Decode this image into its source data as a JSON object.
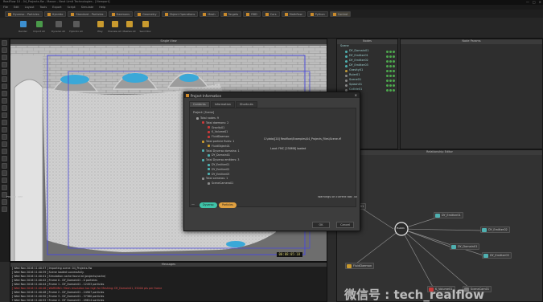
{
  "window": {
    "title": "RealFlow 10 - 04_Projects.flw - Maxon - Next Limit Technologies - [Viewport]"
  },
  "menu": [
    "File",
    "Edit",
    "Layout",
    "Tools",
    "Export",
    "Script",
    "Simulate",
    "Help"
  ],
  "shelf_tabs": [
    {
      "label": "Dyverso - Particles"
    },
    {
      "label": "Hybrido"
    },
    {
      "label": "Standard - Particles"
    },
    {
      "label": "Daemons"
    },
    {
      "label": "Geometry"
    },
    {
      "label": "Object Operations"
    },
    {
      "label": "Mesh"
    },
    {
      "label": "Targets"
    },
    {
      "label": "RBD"
    },
    {
      "label": "Cars"
    },
    {
      "label": "Mathflow"
    },
    {
      "label": "Python"
    },
    {
      "label": "Control",
      "active": true
    }
  ],
  "tools": [
    {
      "label": "Render",
      "color": "#3c8fd0"
    },
    {
      "label": "Import All",
      "color": "#4a9a4a"
    },
    {
      "label": "Dyverso All",
      "color": "#5a5a5a"
    },
    {
      "label": "Hybrido All",
      "color": "#5a5a5a"
    },
    {
      "label": "Play",
      "color": "#c99a2e"
    },
    {
      "label": "Preview All",
      "color": "#c99a2e"
    },
    {
      "label": "Meshes All",
      "color": "#c99a2e"
    },
    {
      "label": "Send Rov",
      "color": "#c99a2e"
    }
  ],
  "viewport": {
    "title": "Single View",
    "timecode": "00:08:05:18"
  },
  "outliner": {
    "title": "Nodes",
    "root": "Scene",
    "items": [
      {
        "label": "DY_Domain01",
        "color": "#4fb0b0"
      },
      {
        "label": "DY_Emitter01",
        "color": "#4fb0b0"
      },
      {
        "label": "DY_Emitter02",
        "color": "#4fb0b0"
      },
      {
        "label": "DY_Emitter03",
        "color": "#4fb0b0"
      },
      {
        "label": "Gravity01",
        "color": "#c09b3a"
      },
      {
        "label": "Ruler01",
        "color": "#8a8a8a"
      },
      {
        "label": "Scene01",
        "color": "#8a8a8a"
      },
      {
        "label": "Splash01",
        "color": "#8a8a8a"
      },
      {
        "label": "Collide01",
        "color": "#8a8a8a"
      }
    ]
  },
  "node_params": {
    "title": "Node Params"
  },
  "relationship_editor": {
    "title": "Relationship Editor",
    "nodes": [
      {
        "label": "Gravity01",
        "color": "#c93a3a"
      },
      {
        "label": "DY_Emitter01",
        "color": "#4fb0b0"
      },
      {
        "label": "DY_Domain01",
        "color": "#4fb0b0"
      },
      {
        "label": "DY_Emitter02",
        "color": "#4fb0b0"
      },
      {
        "label": "DY_Emitter03",
        "color": "#4fb0b0"
      },
      {
        "label": "FluidDaemon",
        "color": "#c99a2e"
      },
      {
        "label": "K_Volume01",
        "color": "#c93a3a"
      },
      {
        "label": "SceneCam01",
        "color": "#7a7a7a"
      }
    ],
    "hub_label": "Hub01"
  },
  "console": {
    "title": "Messages",
    "lines": [
      {
        "text": "[  Wed Nov 2016  11:40:37  ] Importing scene: 04_Projects.flw",
        "kind": "info"
      },
      {
        "text": "[  Wed Nov 2016  11:40:39  ] Scene loaded successfully.",
        "kind": "info"
      },
      {
        "text": "[  Wed Nov 2016  11:40:41  ] Simulation cache found at /projects/cache/",
        "kind": "info"
      },
      {
        "text": "[  Wed Nov 2016  11:40:42  ] Frame 0 - DY_Domain01 - 0 particles",
        "kind": "info"
      },
      {
        "text": "[  Wed Nov 2016  11:40:44  ] Frame 1 - DY_Domain01 - 12453 particles",
        "kind": "info"
      },
      {
        "text": "[  Wed Nov 2016  11:40:46  ] WARNING: Mesh resolution too high for Meshing: DY_Domain01, 25000 pts per frame",
        "kind": "err"
      },
      {
        "text": "[  Wed Nov 2016  11:40:48  ] Frame 2 - DY_Domain01 - 24907 particles",
        "kind": "info"
      },
      {
        "text": "[  Wed Nov 2016  11:40:50  ] Frame 3 - DY_Domain01 - 37360 particles",
        "kind": "info"
      },
      {
        "text": "[  Wed Nov 2016  11:40:52  ] Frame 4 - DY_Domain01 - 49814 particles",
        "kind": "info"
      }
    ]
  },
  "dialog": {
    "title": "Project Information",
    "tabs": [
      "Contents",
      "Information",
      "Shortcuts"
    ],
    "project_label": "Project: [Scene]",
    "tree": [
      {
        "label": "Total nodes: 9",
        "color": "#9a9a9a",
        "indent": 0
      },
      {
        "label": "Total daemons: 2",
        "color": "#c93a3a",
        "indent": 1
      },
      {
        "label": "Gravity01",
        "color": "#c93a3a",
        "indent": 2
      },
      {
        "label": "K_Volume01",
        "color": "#c93a3a",
        "indent": 2
      },
      {
        "label": "FluidDaemon",
        "color": "#c93a3a",
        "indent": 2
      },
      {
        "label": "Total particle fluids: 1",
        "color": "#c99a2e",
        "indent": 1
      },
      {
        "label": "FluidObject01",
        "color": "#c99a2e",
        "indent": 2
      },
      {
        "label": "Total Dyverso domains: 1",
        "color": "#4fb0b0",
        "indent": 1
      },
      {
        "label": "DY_Domain01",
        "color": "#4fb0b0",
        "indent": 2
      },
      {
        "label": "Total Dyverso emitters: 3",
        "color": "#4fb0b0",
        "indent": 1
      },
      {
        "label": "DY_Emitter01",
        "color": "#4fb0b0",
        "indent": 2
      },
      {
        "label": "DY_Emitter02",
        "color": "#4fb0b0",
        "indent": 2
      },
      {
        "label": "DY_Emitter03",
        "color": "#4fb0b0",
        "indent": 2
      },
      {
        "label": "Total cameras: 1",
        "color": "#8a8a8a",
        "indent": 1
      },
      {
        "label": "SceneCamera01",
        "color": "#8a8a8a",
        "indent": 2
      }
    ],
    "annotation_1": "C:\\data\\[20] Realflow\\Examples\\04_Projects_Files\\Scene.rfl",
    "annotation_2": "Load: FMC [238MB] loaded",
    "project_tree_label": "Project Tree",
    "warning_label": "Warnings on current tab: 40",
    "pills": [
      {
        "label": "Dyverso",
        "color": "#3fc3a8"
      },
      {
        "label": "Particles",
        "color": "#e0a040"
      }
    ],
    "ok_label": "OK",
    "cancel_label": "Cancel"
  },
  "watermark": "微信号 : tech_realflow"
}
